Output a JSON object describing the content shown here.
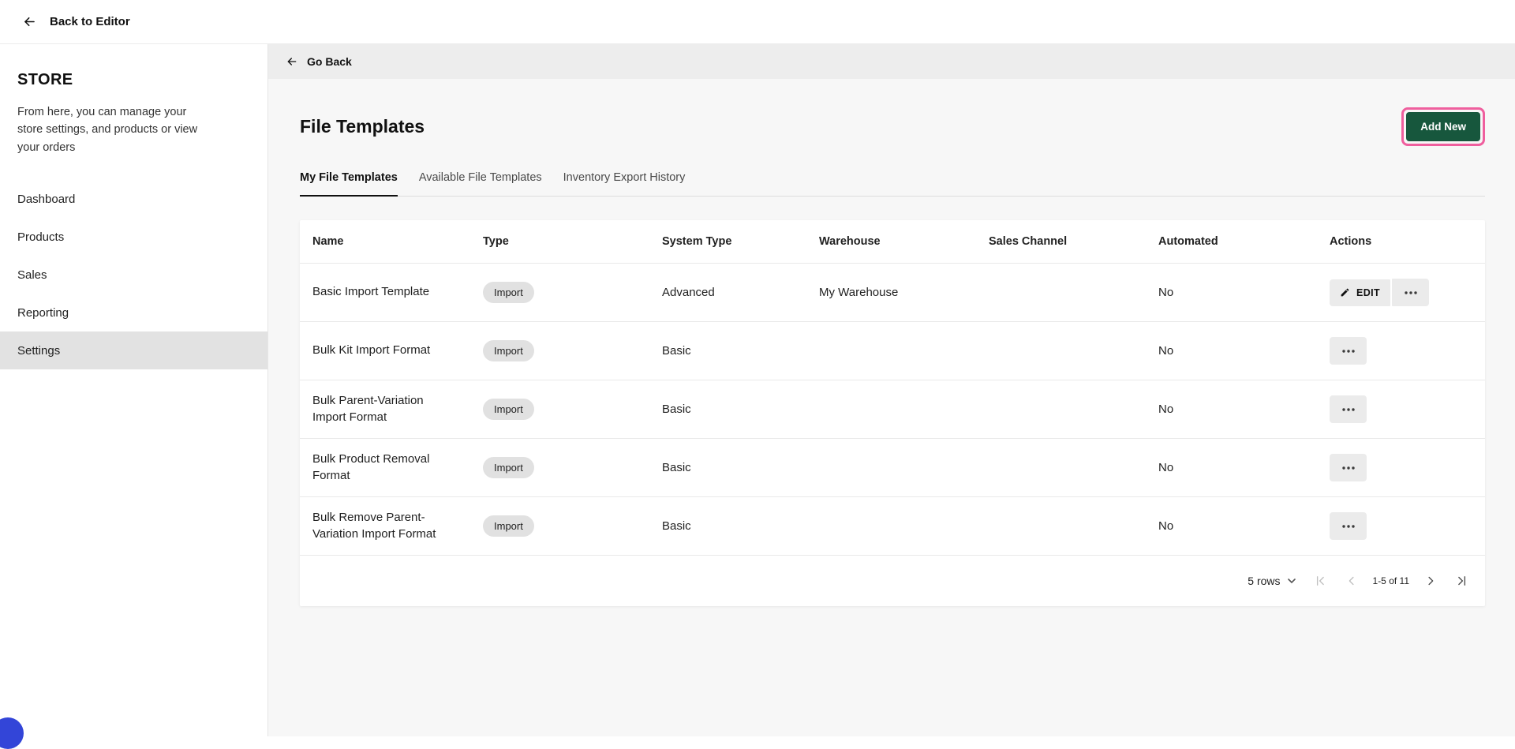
{
  "topbar": {
    "back_label": "Back to Editor"
  },
  "sidebar": {
    "title": "STORE",
    "description": "From here, you can manage your store settings, and products or view your orders",
    "items": [
      {
        "label": "Dashboard"
      },
      {
        "label": "Products"
      },
      {
        "label": "Sales"
      },
      {
        "label": "Reporting"
      },
      {
        "label": "Settings"
      }
    ],
    "active_item": "Settings"
  },
  "main": {
    "go_back_label": "Go Back",
    "page_title": "File Templates",
    "add_new_label": "Add New",
    "tabs": [
      {
        "label": "My File Templates"
      },
      {
        "label": "Available File Templates"
      },
      {
        "label": "Inventory Export History"
      }
    ],
    "active_tab": "My File Templates",
    "table": {
      "columns": [
        "Name",
        "Type",
        "System Type",
        "Warehouse",
        "Sales Channel",
        "Automated",
        "Actions"
      ],
      "edit_label": "EDIT",
      "rows": [
        {
          "name": "Basic Import Template",
          "type": "Import",
          "system_type": "Advanced",
          "warehouse": "My Warehouse",
          "sales_channel": "",
          "automated": "No"
        },
        {
          "name": "Bulk Kit Import Format",
          "type": "Import",
          "system_type": "Basic",
          "warehouse": "",
          "sales_channel": "",
          "automated": "No"
        },
        {
          "name": "Bulk Parent-Variation Import Format",
          "type": "Import",
          "system_type": "Basic",
          "warehouse": "",
          "sales_channel": "",
          "automated": "No"
        },
        {
          "name": "Bulk Product Removal Format",
          "type": "Import",
          "system_type": "Basic",
          "warehouse": "",
          "sales_channel": "",
          "automated": "No"
        },
        {
          "name": "Bulk Remove Parent-Variation Import Format",
          "type": "Import",
          "system_type": "Basic",
          "warehouse": "",
          "sales_channel": "",
          "automated": "No"
        }
      ],
      "pagination": {
        "rows_per_page": "5 rows",
        "range": "1-5 of 11"
      }
    }
  },
  "colors": {
    "accent_green": "#17573d",
    "annotation_pink": "#ef5f9e"
  }
}
